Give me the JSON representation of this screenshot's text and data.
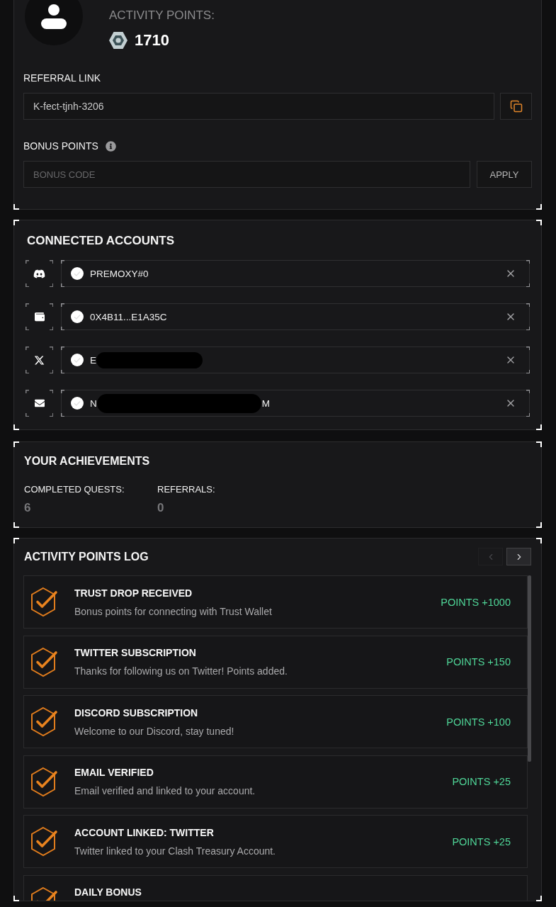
{
  "profile": {
    "points_label": "ACTIVITY POINTS:",
    "points": "1710"
  },
  "referral": {
    "label": "REFERRAL LINK",
    "value": "K-fect-tjnh-3206"
  },
  "bonus": {
    "label": "BONUS POINTS",
    "placeholder": "BONUS CODE",
    "button": "APPLY"
  },
  "connected_accounts": {
    "title": "CONNECTED ACCOUNTS",
    "accounts": [
      {
        "kind": "discord",
        "value": "PREMOXY#0",
        "redacted": false
      },
      {
        "kind": "wallet",
        "value": "0X4B11...E1A35C",
        "redacted": false
      },
      {
        "kind": "x",
        "value": "E",
        "redacted": true
      },
      {
        "kind": "email",
        "value": "N",
        "redacted": true,
        "value_end": "M"
      }
    ]
  },
  "achievements": {
    "title": "YOUR ACHIEVEMENTS",
    "stats": [
      {
        "label": "COMPLETED QUESTS:",
        "value": "6"
      },
      {
        "label": "REFERRALS:",
        "value": "0"
      }
    ]
  },
  "points_log": {
    "title": "ACTIVITY POINTS LOG",
    "pager": [
      {
        "kind": "prev",
        "disabled": true
      },
      {
        "kind": "next",
        "disabled": false
      }
    ],
    "entries": [
      {
        "title": "TRUST DROP RECEIVED",
        "description": "Bonus points for connecting with Trust Wallet",
        "points": "POINTS +1000"
      },
      {
        "title": "TWITTER SUBSCRIPTION",
        "description": "Thanks for following us on Twitter! Points added.",
        "points": "POINTS +150"
      },
      {
        "title": "DISCORD SUBSCRIPTION",
        "description": "Welcome to our Discord, stay tuned!",
        "points": "POINTS +100"
      },
      {
        "title": "EMAIL VERIFIED",
        "description": "Email verified and linked to your account.",
        "points": "POINTS +25"
      },
      {
        "title": "ACCOUNT LINKED: TWITTER",
        "description": "Twitter linked to your Clash Treasury Account.",
        "points": "POINTS +25"
      },
      {
        "title": "DAILY BONUS"
      }
    ]
  }
}
